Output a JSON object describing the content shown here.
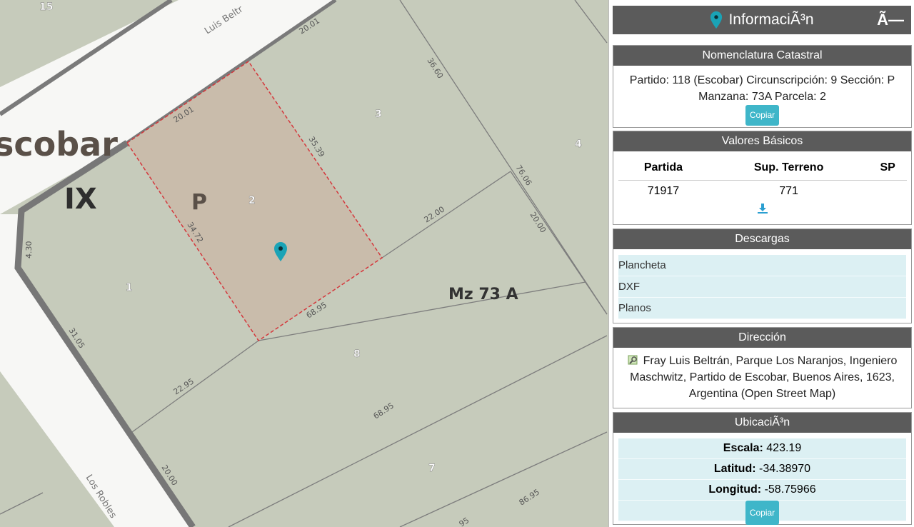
{
  "map": {
    "labels": {
      "town": "scobar",
      "circ": "IX",
      "section": "P",
      "block": "Mz 73 A",
      "street_top": "Luis Beltr",
      "street_bottom": "Los Robles",
      "lot_15": "15",
      "lot_1": "1",
      "lot_2": "2",
      "lot_3": "3",
      "lot_4": "4",
      "lot_7": "7",
      "lot_8": "8"
    },
    "dims": {
      "d_2001a": "20.01",
      "d_2001b": "20.01",
      "d_3660": "36.60",
      "d_3539": "35.39",
      "d_7606": "76.06",
      "d_2200": "22.00",
      "d_2000a": "20.00",
      "d_3472": "34.72",
      "d_430": "4.30",
      "d_6895a": "68.95",
      "d_3105": "31.05",
      "d_2295": "22.95",
      "d_6895b": "68.95",
      "d_2000b": "20.00",
      "d_8695": "86.95",
      "d_95": "95"
    },
    "colors": {
      "land": "#c6cbbb",
      "road": "#f8f8f6",
      "parcel_fill": "#c9bcab",
      "parcel_border": "#d4373c",
      "marker": "#1aa3b6"
    }
  },
  "panel": {
    "header": {
      "title": "InformaciÃ³n",
      "close": "Ã—"
    },
    "catastral": {
      "title": "Nomenclatura Catastral",
      "line1": "Partido: 118 (Escobar) Circunscripción: 9 Sección: P",
      "line2": "Manzana: 73A Parcela: 2",
      "copy": "Copiar"
    },
    "valores": {
      "title": "Valores Básicos",
      "headers": [
        "Partida",
        "Sup. Terreno",
        "SP"
      ],
      "row": [
        "71917",
        "771",
        ""
      ]
    },
    "descargas": {
      "title": "Descargas",
      "items": [
        "Plancheta",
        "DXF",
        "Planos"
      ]
    },
    "direccion": {
      "title": "Dirección",
      "text": "Fray Luis Beltrán, Parque Los Naranjos, Ingeniero Maschwitz, Partido de Escobar, Buenos Aires, 1623, Argentina (Open Street Map)"
    },
    "ubicacion": {
      "title": "UbicaciÃ³n",
      "escala_label": "Escala:",
      "escala": "423.19",
      "lat_label": "Latitud:",
      "lat": "-34.38970",
      "lon_label": "Longitud:",
      "lon": "-58.75966",
      "copy": "Copiar"
    }
  }
}
